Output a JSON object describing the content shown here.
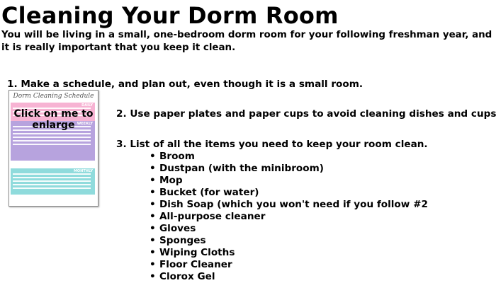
{
  "page": {
    "title": "Cleaning Your Dorm Room",
    "intro": "You will be living in a small, one-bedroom dorm room for your following freshman year, and it is really important that you keep it clean."
  },
  "steps": [
    "1. Make a schedule, and plan out, even though it is a small room.",
    "2. Use paper plates and paper cups to avoid cleaning dishes and cups.",
    "3. List of all the items you need to keep your room clean."
  ],
  "thumbnail": {
    "heading": "Dorm Cleaning Schedule",
    "overlay_line1": "Click on me to",
    "overlay_line2": "enlarge",
    "band_daily": "DAILY",
    "band_weekly": "WEEKLY",
    "band_monthly": "MONTHLY",
    "colors": {
      "pink": "#f7b3d3",
      "purple": "#b7a3de",
      "teal": "#8fdbdc"
    }
  },
  "bullet_glyph": "•",
  "items": [
    "Broom",
    "Dustpan (with the minibroom)",
    "Mop",
    "Bucket (for water)",
    "Dish Soap (which you won't need if you follow #2",
    "All-purpose cleaner",
    "Gloves",
    "Sponges",
    "Wiping Cloths",
    "Floor Cleaner",
    "Clorox Gel"
  ]
}
